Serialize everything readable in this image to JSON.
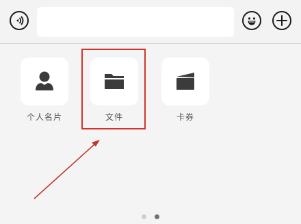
{
  "input_bar": {
    "voice_icon": "voice-input-icon",
    "text_value": "",
    "emoji_icon": "emoji-icon",
    "plus_icon": "plus-icon"
  },
  "panel": {
    "items": [
      {
        "label": "个人名片",
        "icon": "person-icon"
      },
      {
        "label": "文件",
        "icon": "folder-icon"
      },
      {
        "label": "卡券",
        "icon": "wallet-icon"
      }
    ],
    "page_count": 2,
    "current_page": 2
  },
  "annotation": {
    "highlight_target": "文件",
    "color": "#d0342c"
  }
}
